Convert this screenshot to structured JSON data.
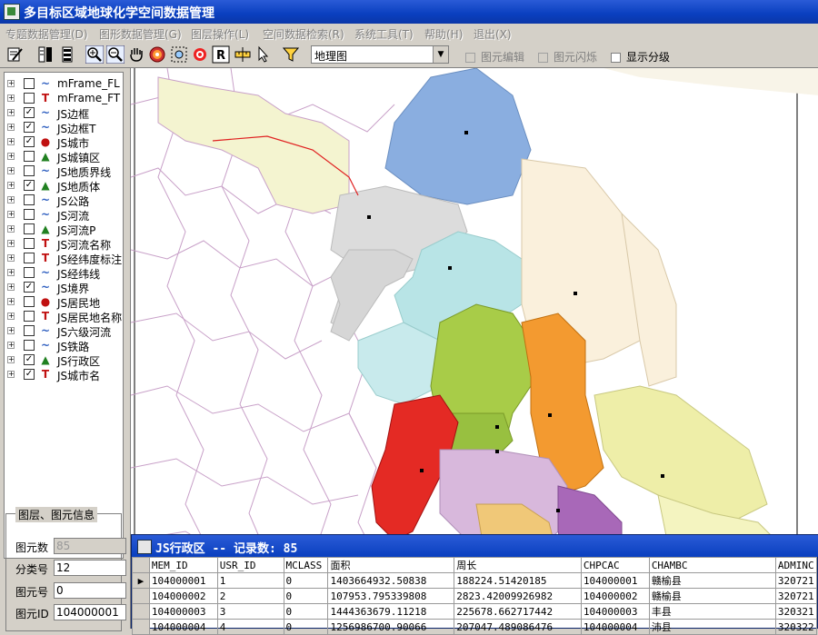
{
  "window": {
    "title": "多目标区域地球化学空间数据管理"
  },
  "menu": [
    {
      "label": "专题数据管理(D)"
    },
    {
      "label": "图形数据管理(G)"
    },
    {
      "label": "图层操作(L)"
    },
    {
      "label": "空间数据检索(R)"
    },
    {
      "label": "系统工具(T)"
    },
    {
      "label": "帮助(H)"
    },
    {
      "label": "退出(X)"
    }
  ],
  "toolbar": {
    "map_select": {
      "value": "地理图"
    },
    "checkboxes": [
      {
        "label": "图元编辑",
        "checked": false,
        "enabled": false
      },
      {
        "label": "图元闪烁",
        "checked": false,
        "enabled": false
      },
      {
        "label": "显示分级",
        "checked": false,
        "enabled": true
      }
    ],
    "icons": [
      "layer-edit-icon",
      "layer-list-icon",
      "layer-stack-icon",
      "zoom-in-icon",
      "zoom-out-icon",
      "pan-hand-icon",
      "target-icon",
      "lasso-select-icon",
      "clear-select-icon",
      "refresh-icon",
      "ruler-icon",
      "pointer-icon",
      "filter-icon"
    ]
  },
  "layers": [
    {
      "label": "mFrame_FL",
      "checked": false,
      "type": "line"
    },
    {
      "label": "mFrame_FT",
      "checked": false,
      "type": "text"
    },
    {
      "label": "JS边框",
      "checked": true,
      "type": "line"
    },
    {
      "label": "JS边框T",
      "checked": true,
      "type": "line"
    },
    {
      "label": "JS城市",
      "checked": true,
      "type": "point"
    },
    {
      "label": "JS城镇区",
      "checked": false,
      "type": "area"
    },
    {
      "label": "JS地质界线",
      "checked": false,
      "type": "line"
    },
    {
      "label": "JS地质体",
      "checked": true,
      "type": "area"
    },
    {
      "label": "JS公路",
      "checked": false,
      "type": "line"
    },
    {
      "label": "JS河流",
      "checked": false,
      "type": "line"
    },
    {
      "label": "JS河流P",
      "checked": false,
      "type": "area"
    },
    {
      "label": "JS河流名称",
      "checked": false,
      "type": "text"
    },
    {
      "label": "JS经纬度标注",
      "checked": false,
      "type": "text"
    },
    {
      "label": "JS经纬线",
      "checked": false,
      "type": "line"
    },
    {
      "label": "JS境界",
      "checked": true,
      "type": "line"
    },
    {
      "label": "JS居民地",
      "checked": false,
      "type": "point"
    },
    {
      "label": "JS居民地名称",
      "checked": false,
      "type": "text"
    },
    {
      "label": "JS六级河流",
      "checked": false,
      "type": "line"
    },
    {
      "label": "JS铁路",
      "checked": false,
      "type": "line"
    },
    {
      "label": "JS行政区",
      "checked": true,
      "type": "area"
    },
    {
      "label": "JS城市名",
      "checked": true,
      "type": "text"
    }
  ],
  "info_panel": {
    "legend": "图层、图元信息",
    "fields": [
      {
        "label": "图元数",
        "value": "85",
        "disabled": true
      },
      {
        "label": "分类号",
        "value": "12",
        "disabled": false
      },
      {
        "label": "图元号",
        "value": "0",
        "disabled": false
      },
      {
        "label": "图元ID",
        "value": "104000001",
        "disabled": false
      }
    ]
  },
  "attribute_table": {
    "title": "JS行政区 -- 记录数: 85",
    "columns": [
      "MEM_ID",
      "USR_ID",
      "MCLASS",
      "面积",
      "周长",
      "CHPCAC",
      "CHAMBC",
      "ADMINC"
    ],
    "rows": [
      [
        "104000001",
        "1",
        "0",
        "1403664932.50838",
        "188224.51420185",
        "104000001",
        "赣榆县",
        "320721"
      ],
      [
        "104000002",
        "2",
        "0",
        "107953.795339808",
        "2823.42009926982",
        "104000002",
        "赣榆县",
        "320721"
      ],
      [
        "104000003",
        "3",
        "0",
        "1444363679.11218",
        "225678.662717442",
        "104000003",
        "丰县",
        "320321"
      ],
      [
        "104000004",
        "4",
        "0",
        "1256986700.90066",
        "207047.489086476",
        "104000004",
        "沛县",
        "320322"
      ]
    ]
  }
}
